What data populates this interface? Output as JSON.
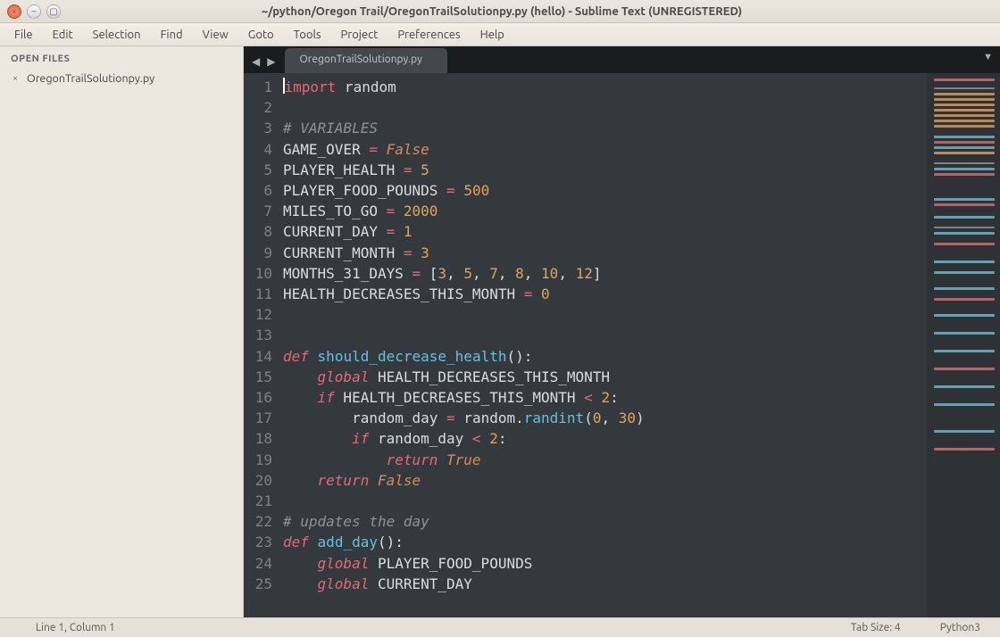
{
  "window": {
    "title": "~/python/Oregon Trail/OregonTrailSolutionpy.py (hello) - Sublime Text (UNREGISTERED)"
  },
  "menu": [
    "File",
    "Edit",
    "Selection",
    "Find",
    "View",
    "Goto",
    "Tools",
    "Project",
    "Preferences",
    "Help"
  ],
  "sidebar": {
    "header": "OPEN FILES",
    "open_files": [
      "OregonTrailSolutionpy.py"
    ]
  },
  "tab": {
    "label": "OregonTrailSolutionpy.py"
  },
  "code": {
    "lines": [
      [
        {
          "t": "cursor"
        },
        {
          "t": "kw-import",
          "v": "import"
        },
        {
          "t": "ident",
          "v": " random"
        }
      ],
      [],
      [
        {
          "t": "comment",
          "v": "# VARIABLES"
        }
      ],
      [
        {
          "t": "ident",
          "v": "GAME_OVER "
        },
        {
          "t": "op",
          "v": "="
        },
        {
          "t": "ident",
          "v": " "
        },
        {
          "t": "const",
          "v": "False"
        }
      ],
      [
        {
          "t": "ident",
          "v": "PLAYER_HEALTH "
        },
        {
          "t": "op",
          "v": "="
        },
        {
          "t": "ident",
          "v": " "
        },
        {
          "t": "num",
          "v": "5"
        }
      ],
      [
        {
          "t": "ident",
          "v": "PLAYER_FOOD_POUNDS "
        },
        {
          "t": "op",
          "v": "="
        },
        {
          "t": "ident",
          "v": " "
        },
        {
          "t": "num",
          "v": "500"
        }
      ],
      [
        {
          "t": "ident",
          "v": "MILES_TO_GO "
        },
        {
          "t": "op",
          "v": "="
        },
        {
          "t": "ident",
          "v": " "
        },
        {
          "t": "num",
          "v": "2000"
        }
      ],
      [
        {
          "t": "ident",
          "v": "CURRENT_DAY "
        },
        {
          "t": "op",
          "v": "="
        },
        {
          "t": "ident",
          "v": " "
        },
        {
          "t": "num",
          "v": "1"
        }
      ],
      [
        {
          "t": "ident",
          "v": "CURRENT_MONTH "
        },
        {
          "t": "op",
          "v": "="
        },
        {
          "t": "ident",
          "v": " "
        },
        {
          "t": "num",
          "v": "3"
        }
      ],
      [
        {
          "t": "ident",
          "v": "MONTHS_31_DAYS "
        },
        {
          "t": "op",
          "v": "="
        },
        {
          "t": "ident",
          "v": " "
        },
        {
          "t": "punct",
          "v": "["
        },
        {
          "t": "num",
          "v": "3"
        },
        {
          "t": "punct",
          "v": ", "
        },
        {
          "t": "num",
          "v": "5"
        },
        {
          "t": "punct",
          "v": ", "
        },
        {
          "t": "num",
          "v": "7"
        },
        {
          "t": "punct",
          "v": ", "
        },
        {
          "t": "num",
          "v": "8"
        },
        {
          "t": "punct",
          "v": ", "
        },
        {
          "t": "num",
          "v": "10"
        },
        {
          "t": "punct",
          "v": ", "
        },
        {
          "t": "num",
          "v": "12"
        },
        {
          "t": "punct",
          "v": "]"
        }
      ],
      [
        {
          "t": "ident",
          "v": "HEALTH_DECREASES_THIS_MONTH "
        },
        {
          "t": "op",
          "v": "="
        },
        {
          "t": "ident",
          "v": " "
        },
        {
          "t": "num",
          "v": "0"
        }
      ],
      [],
      [],
      [
        {
          "t": "kw-def",
          "v": "def"
        },
        {
          "t": "ident",
          "v": " "
        },
        {
          "t": "fn",
          "v": "should_decrease_health"
        },
        {
          "t": "paren",
          "v": "()"
        },
        {
          "t": "punct",
          "v": ":"
        }
      ],
      [
        {
          "t": "ident",
          "v": "    "
        },
        {
          "t": "kw-global",
          "v": "global"
        },
        {
          "t": "ident",
          "v": " HEALTH_DECREASES_THIS_MONTH"
        }
      ],
      [
        {
          "t": "ident",
          "v": "    "
        },
        {
          "t": "kw-ctrl",
          "v": "if"
        },
        {
          "t": "ident",
          "v": " HEALTH_DECREASES_THIS_MONTH "
        },
        {
          "t": "op",
          "v": "<"
        },
        {
          "t": "ident",
          "v": " "
        },
        {
          "t": "num",
          "v": "2"
        },
        {
          "t": "punct",
          "v": ":"
        }
      ],
      [
        {
          "t": "ident",
          "v": "        random_day "
        },
        {
          "t": "op",
          "v": "="
        },
        {
          "t": "ident",
          "v": " random"
        },
        {
          "t": "dot",
          "v": "."
        },
        {
          "t": "fn",
          "v": "randint"
        },
        {
          "t": "paren",
          "v": "("
        },
        {
          "t": "num",
          "v": "0"
        },
        {
          "t": "punct",
          "v": ", "
        },
        {
          "t": "num",
          "v": "30"
        },
        {
          "t": "paren",
          "v": ")"
        }
      ],
      [
        {
          "t": "ident",
          "v": "        "
        },
        {
          "t": "kw-ctrl",
          "v": "if"
        },
        {
          "t": "ident",
          "v": " random_day "
        },
        {
          "t": "op",
          "v": "<"
        },
        {
          "t": "ident",
          "v": " "
        },
        {
          "t": "num",
          "v": "2"
        },
        {
          "t": "punct",
          "v": ":"
        }
      ],
      [
        {
          "t": "ident",
          "v": "            "
        },
        {
          "t": "kw-ctrl",
          "v": "return"
        },
        {
          "t": "ident",
          "v": " "
        },
        {
          "t": "const",
          "v": "True"
        }
      ],
      [
        {
          "t": "ident",
          "v": "    "
        },
        {
          "t": "kw-ctrl",
          "v": "return"
        },
        {
          "t": "ident",
          "v": " "
        },
        {
          "t": "const",
          "v": "False"
        }
      ],
      [],
      [
        {
          "t": "comment",
          "v": "# updates the day"
        }
      ],
      [
        {
          "t": "kw-def",
          "v": "def"
        },
        {
          "t": "ident",
          "v": " "
        },
        {
          "t": "fn",
          "v": "add_day"
        },
        {
          "t": "paren",
          "v": "()"
        },
        {
          "t": "punct",
          "v": ":"
        }
      ],
      [
        {
          "t": "ident",
          "v": "    "
        },
        {
          "t": "kw-global",
          "v": "global"
        },
        {
          "t": "ident",
          "v": " PLAYER_FOOD_POUNDS"
        }
      ],
      [
        {
          "t": "ident",
          "v": "    "
        },
        {
          "t": "kw-global",
          "v": "global"
        },
        {
          "t": "ident",
          "v": " CURRENT_DAY"
        }
      ]
    ]
  },
  "status": {
    "position": "Line 1, Column 1",
    "tab_size": "Tab Size: 4",
    "syntax": "Python3"
  }
}
